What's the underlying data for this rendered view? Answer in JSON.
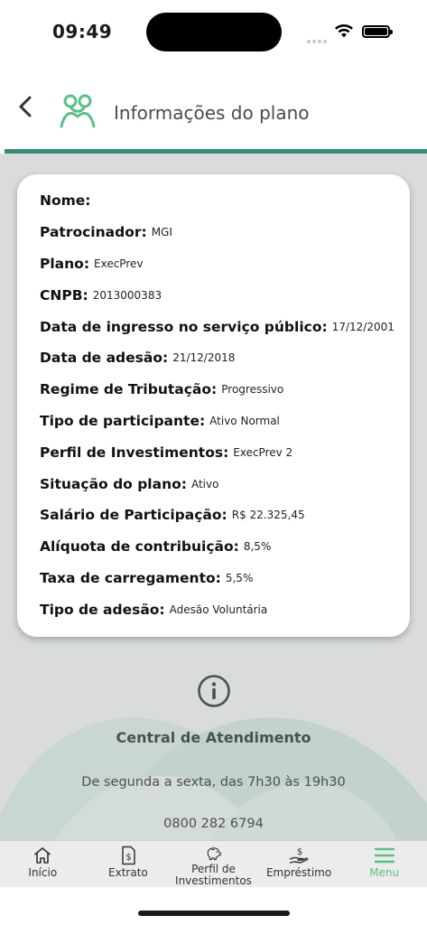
{
  "status_bar": {
    "time": "09:49"
  },
  "header": {
    "title": "Informações do plano"
  },
  "fields": [
    {
      "label": "Nome:",
      "value": ""
    },
    {
      "label": "Patrocinador:",
      "value": "MGI"
    },
    {
      "label": "Plano:",
      "value": "ExecPrev"
    },
    {
      "label": "CNPB:",
      "value": "2013000383"
    },
    {
      "label": "Data de ingresso no serviço público:",
      "value": "17/12/2001"
    },
    {
      "label": "Data de adesão:",
      "value": "21/12/2018"
    },
    {
      "label": "Regime de Tributação:",
      "value": "Progressivo"
    },
    {
      "label": "Tipo de participante:",
      "value": "Ativo Normal"
    },
    {
      "label": "Perfil de Investimentos:",
      "value": "ExecPrev 2"
    },
    {
      "label": "Situação do plano:",
      "value": "Ativo"
    },
    {
      "label": "Salário de Participação:",
      "value": "R$ 22.325,45"
    },
    {
      "label": "Alíquota de contribuição:",
      "value": "8,5%"
    },
    {
      "label": "Taxa de carregamento:",
      "value": "5,5%"
    },
    {
      "label": "Tipo de adesão:",
      "value": "Adesão Voluntária"
    }
  ],
  "central": {
    "title": "Central de Atendimento",
    "hours": "De segunda a sexta, das 7h30 às 19h30",
    "phone": "0800 282 6794"
  },
  "tabbar": {
    "items": [
      {
        "label": "Início",
        "icon": "home-icon"
      },
      {
        "label": "Extrato",
        "icon": "statement-icon"
      },
      {
        "label": "Perfil de Investimentos",
        "icon": "piggy-bank-icon"
      },
      {
        "label": "Empréstimo",
        "icon": "loan-hand-icon"
      },
      {
        "label": "Menu",
        "icon": "menu-icon"
      }
    ],
    "active": "Menu"
  },
  "colors": {
    "accent": "#3c8a78",
    "active_tab": "#5cbf8a",
    "background": "#d9dcdb"
  }
}
